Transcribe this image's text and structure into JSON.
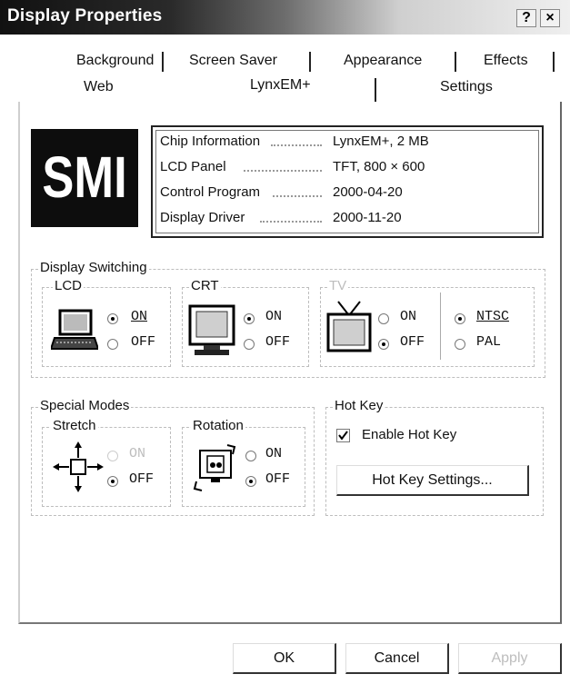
{
  "window": {
    "title": "Display Properties",
    "help_glyph": "?",
    "close_glyph": "×"
  },
  "tabs": {
    "row1": [
      "Background",
      "Screen Saver",
      "Appearance",
      "Effects"
    ],
    "row2": [
      "Web",
      "LynxEM+",
      "Settings"
    ],
    "active": "LynxEM+"
  },
  "logo": {
    "text": "SMI"
  },
  "info": {
    "rows": [
      {
        "label": "Chip Information",
        "value": "LynxEM+, 2 MB"
      },
      {
        "label": "LCD Panel",
        "value": "TFT, 800 × 600"
      },
      {
        "label": "Control Program",
        "value": "2000-04-20"
      },
      {
        "label": "Display Driver",
        "value": "2000-11-20"
      }
    ]
  },
  "display_switching": {
    "legend": "Display Switching",
    "lcd": {
      "legend": "LCD",
      "on_label": "ON",
      "off_label": "OFF",
      "selected": "ON",
      "icon": "laptop-icon"
    },
    "crt": {
      "legend": "CRT",
      "on_label": "ON",
      "off_label": "OFF",
      "selected": "ON",
      "icon": "monitor-icon"
    },
    "tv": {
      "legend": "TV",
      "on_label": "ON",
      "off_label": "OFF",
      "selected": "OFF",
      "icon": "tv-icon",
      "ntsc_label": "NTSC",
      "pal_label": "PAL",
      "standard_selected": "NTSC"
    }
  },
  "special_modes": {
    "legend": "Special Modes",
    "stretch": {
      "legend": "Stretch",
      "on_label": "ON",
      "off_label": "OFF",
      "selected": "OFF",
      "on_disabled": true,
      "icon": "stretch-arrows-icon"
    },
    "rotation": {
      "legend": "Rotation",
      "on_label": "ON",
      "off_label": "OFF",
      "selected": "OFF",
      "icon": "rotate-screen-icon"
    }
  },
  "hot_key": {
    "legend": "Hot Key",
    "enable_label": "Enable Hot Key",
    "enabled": true,
    "settings_button": "Hot Key Settings..."
  },
  "footer": {
    "ok": "OK",
    "cancel": "Cancel",
    "apply": "Apply"
  }
}
